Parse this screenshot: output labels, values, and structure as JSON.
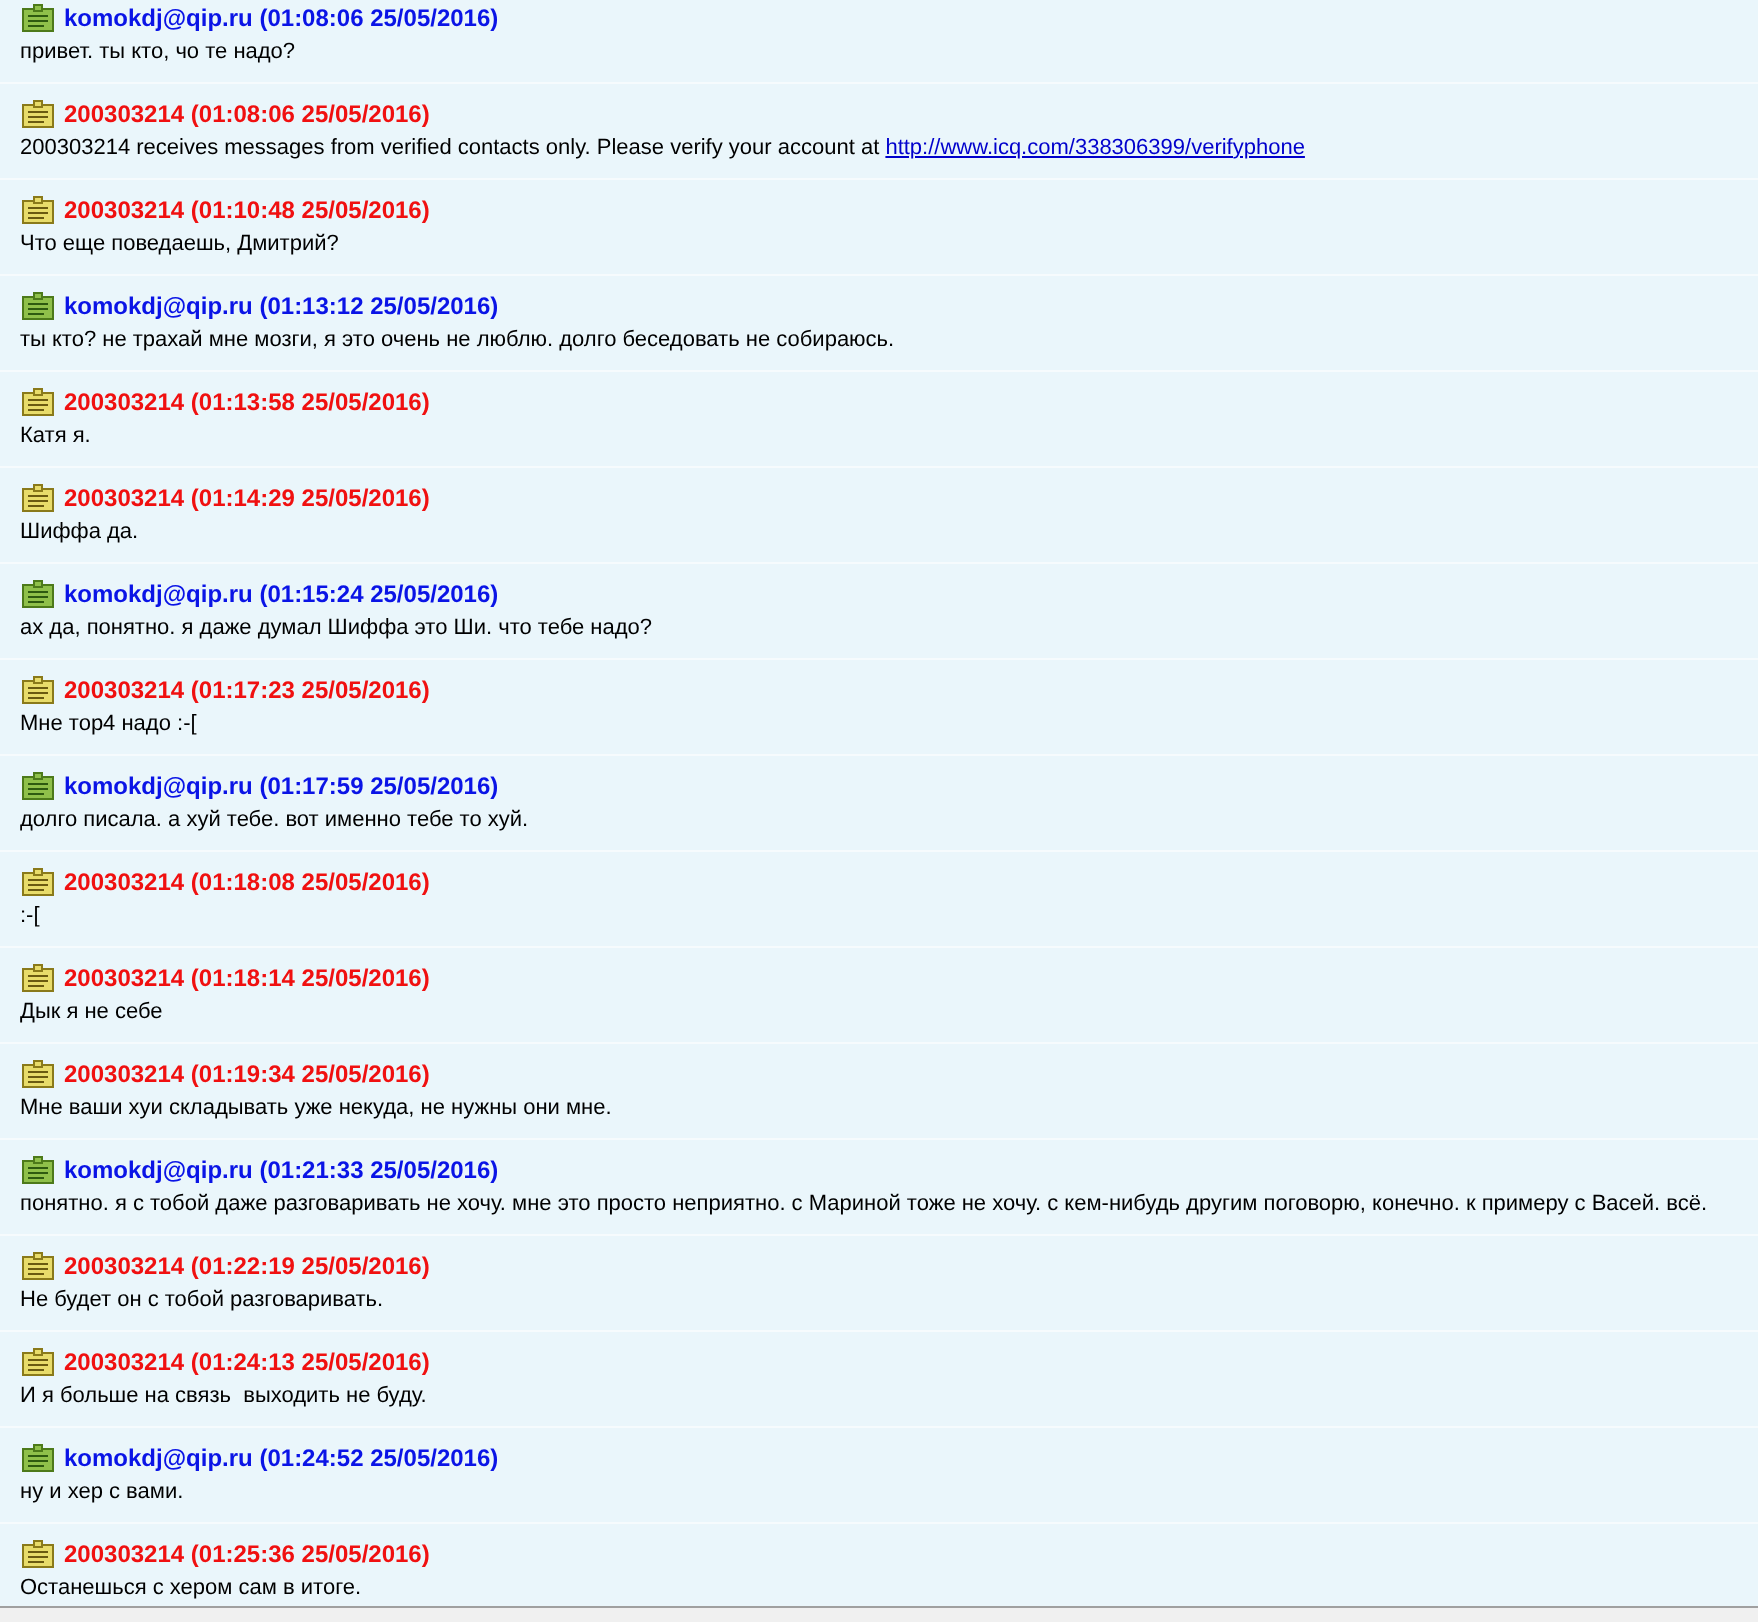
{
  "messages": [
    {
      "kind": "own",
      "sender": "komokdj@qip.ru",
      "time": "(01:08:06 25/05/2016)",
      "text": "привет. ты кто, чо те надо?"
    },
    {
      "kind": "contact",
      "sender": "200303214",
      "time": "(01:08:06 25/05/2016)",
      "text": "200303214 receives messages from verified contacts only. Please verify your account at",
      "link": "http://www.icq.com/338306399/verifyphone"
    },
    {
      "kind": "contact",
      "sender": "200303214",
      "time": "(01:10:48 25/05/2016)",
      "text": "Что еще поведаешь, Дмитрий?"
    },
    {
      "kind": "own",
      "sender": "komokdj@qip.ru",
      "time": "(01:13:12 25/05/2016)",
      "text": "ты кто? не трахай мне мозги, я это очень не люблю. долго беседовать не собираюсь."
    },
    {
      "kind": "contact",
      "sender": "200303214",
      "time": "(01:13:58 25/05/2016)",
      "text": "Катя я."
    },
    {
      "kind": "contact",
      "sender": "200303214",
      "time": "(01:14:29 25/05/2016)",
      "text": "Шиффа да."
    },
    {
      "kind": "own",
      "sender": "komokdj@qip.ru",
      "time": "(01:15:24 25/05/2016)",
      "text": "ах да, понятно. я даже думал Шиффа это Ши. что тебе надо?"
    },
    {
      "kind": "contact",
      "sender": "200303214",
      "time": "(01:17:23 25/05/2016)",
      "text": "Мне тор4 надо :-["
    },
    {
      "kind": "own",
      "sender": "komokdj@qip.ru",
      "time": "(01:17:59 25/05/2016)",
      "text": "долго писала. а хуй тебе. вот именно тебе то хуй."
    },
    {
      "kind": "contact",
      "sender": "200303214",
      "time": "(01:18:08 25/05/2016)",
      "text": ":-["
    },
    {
      "kind": "contact",
      "sender": "200303214",
      "time": "(01:18:14 25/05/2016)",
      "text": "Дык я не себе"
    },
    {
      "kind": "contact",
      "sender": "200303214",
      "time": "(01:19:34 25/05/2016)",
      "text": "Мне ваши хуи складывать уже некуда, не нужны они мне."
    },
    {
      "kind": "own",
      "sender": "komokdj@qip.ru",
      "time": "(01:21:33 25/05/2016)",
      "text": "понятно. я с тобой даже разговаривать не хочу. мне это просто неприятно. с Мариной тоже не хочу. с кем-нибудь другим поговорю, конечно. к примеру с Васей. всё."
    },
    {
      "kind": "contact",
      "sender": "200303214",
      "time": "(01:22:19 25/05/2016)",
      "text": "Не будет он с тобой разговаривать."
    },
    {
      "kind": "contact",
      "sender": "200303214",
      "time": "(01:24:13 25/05/2016)",
      "text": "И я больше на связь  выходить не буду."
    },
    {
      "kind": "own",
      "sender": "komokdj@qip.ru",
      "time": "(01:24:52 25/05/2016)",
      "text": "ну и хер с вами."
    },
    {
      "kind": "contact",
      "sender": "200303214",
      "time": "(01:25:36 25/05/2016)",
      "text": "Останешься с хером сам в итоге."
    }
  ]
}
